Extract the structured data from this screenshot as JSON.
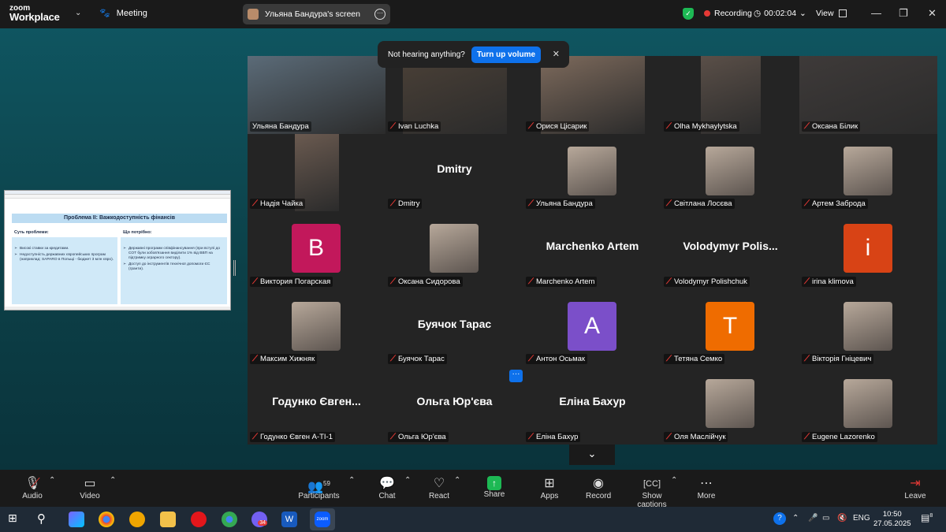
{
  "app": {
    "brand_line1": "zoom",
    "brand_line2": "Workplace",
    "meeting_label": "Meeting"
  },
  "screen_share": {
    "label": "Ульяна Бандура's screen"
  },
  "status": {
    "recording_label": "Recording",
    "timer": "00:02:04",
    "view_label": "View"
  },
  "notification": {
    "text": "Not hearing anything?",
    "button": "Turn up volume"
  },
  "shared_slide": {
    "title": "Проблема ІІ: Важкодоступність фінансів",
    "left_header": "Суть проблеми:",
    "left_items": [
      "Високі ставки за кредитами.",
      "Недоступність державних європейських програм (наприклад: SAPARO в Польщі - бюджет 3 млн євро)."
    ],
    "right_header": "Що потрібно:",
    "right_items": [
      "Державні програми співфінансування (при вступі до СОТ були зобов'язання виділити 1% від ВВП на підтримку аграрного сектору).",
      "Доступ до інструментів технічної допомоги ЄС (гранти)."
    ]
  },
  "participants": [
    {
      "label": "Ульяна Бандура",
      "display": "",
      "avatar_letter": "",
      "avatar_color": "",
      "muted": false,
      "kind": "video"
    },
    {
      "label": "Ivan Luchka",
      "display": "",
      "avatar_letter": "",
      "avatar_color": "",
      "muted": true,
      "kind": "video"
    },
    {
      "label": "Орися Цісарик",
      "display": "",
      "avatar_letter": "",
      "avatar_color": "",
      "muted": true,
      "kind": "video"
    },
    {
      "label": "Olha Mykhaylytska",
      "display": "",
      "avatar_letter": "",
      "avatar_color": "",
      "muted": true,
      "kind": "video"
    },
    {
      "label": "Оксана Білик",
      "display": "",
      "avatar_letter": "",
      "avatar_color": "",
      "muted": true,
      "kind": "video"
    },
    {
      "label": "Надія Чайка",
      "display": "",
      "avatar_letter": "",
      "avatar_color": "",
      "muted": true,
      "kind": "video"
    },
    {
      "label": "Dmitry",
      "display": "Dmitry",
      "avatar_letter": "",
      "avatar_color": "",
      "muted": true,
      "kind": "name"
    },
    {
      "label": "Ульяна Бандура",
      "display": "",
      "avatar_letter": "",
      "avatar_color": "",
      "muted": true,
      "kind": "photo"
    },
    {
      "label": "Світлана Лосєва",
      "display": "",
      "avatar_letter": "",
      "avatar_color": "",
      "muted": true,
      "kind": "photo"
    },
    {
      "label": "Артем Заброда",
      "display": "",
      "avatar_letter": "",
      "avatar_color": "",
      "muted": true,
      "kind": "photo"
    },
    {
      "label": "Виктория Погарская",
      "display": "",
      "avatar_letter": "B",
      "avatar_color": "#c2185b",
      "muted": true,
      "kind": "letter"
    },
    {
      "label": "Оксана Сидорова",
      "display": "",
      "avatar_letter": "",
      "avatar_color": "",
      "muted": true,
      "kind": "photo"
    },
    {
      "label": "Marchenko Artem",
      "display": "Marchenko Artem",
      "avatar_letter": "",
      "avatar_color": "",
      "muted": true,
      "kind": "name"
    },
    {
      "label": "Volodymyr Polishchuk",
      "display": "Volodymyr  Polis...",
      "avatar_letter": "",
      "avatar_color": "",
      "muted": true,
      "kind": "name"
    },
    {
      "label": "irina klimova",
      "display": "",
      "avatar_letter": "i",
      "avatar_color": "#d84315",
      "muted": true,
      "kind": "letter"
    },
    {
      "label": "Максим Хижняк",
      "display": "",
      "avatar_letter": "",
      "avatar_color": "",
      "muted": true,
      "kind": "photo"
    },
    {
      "label": "Буячок Тарас",
      "display": "Буячок Тарас",
      "avatar_letter": "",
      "avatar_color": "",
      "muted": true,
      "kind": "name"
    },
    {
      "label": "Антон Осьмак",
      "display": "",
      "avatar_letter": "A",
      "avatar_color": "#7b4fc9",
      "muted": true,
      "kind": "letter"
    },
    {
      "label": "Тетяна Семко",
      "display": "",
      "avatar_letter": "T",
      "avatar_color": "#ef6c00",
      "muted": true,
      "kind": "letter"
    },
    {
      "label": "Вікторія Гніцевич",
      "display": "",
      "avatar_letter": "",
      "avatar_color": "",
      "muted": true,
      "kind": "photo"
    },
    {
      "label": "Годунко Євген А-ТІ-1",
      "display": "Годунко Євген...",
      "avatar_letter": "",
      "avatar_color": "",
      "muted": true,
      "kind": "name"
    },
    {
      "label": "Ольга Юр'єва",
      "display": "Ольга Юр'єва",
      "avatar_letter": "",
      "avatar_color": "",
      "muted": true,
      "kind": "name"
    },
    {
      "label": "Еліна Бахур",
      "display": "Еліна Бахур",
      "avatar_letter": "",
      "avatar_color": "",
      "muted": true,
      "kind": "name"
    },
    {
      "label": "Оля Маслійчук",
      "display": "",
      "avatar_letter": "",
      "avatar_color": "",
      "muted": true,
      "kind": "photo"
    },
    {
      "label": "Eugene Lazorenko",
      "display": "",
      "avatar_letter": "",
      "avatar_color": "",
      "muted": true,
      "kind": "photo"
    }
  ],
  "toolbar": {
    "audio": "Audio",
    "video": "Video",
    "participants": "Participants",
    "participants_count": "59",
    "chat": "Chat",
    "react": "React",
    "share": "Share",
    "apps": "Apps",
    "record": "Record",
    "captions": "Show captions",
    "more": "More",
    "leave": "Leave"
  },
  "taskbar": {
    "lang": "ENG",
    "time": "10:50",
    "date": "27.05.2025",
    "viber_badge": "34",
    "notif_badge": "8"
  }
}
